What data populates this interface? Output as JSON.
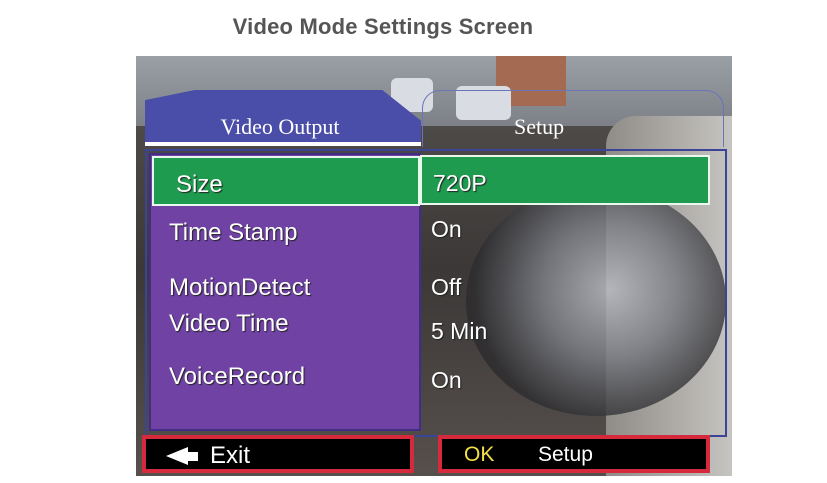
{
  "caption": "Video Mode Settings Screen",
  "tabs": {
    "active": "Video Output",
    "inactive": "Setup"
  },
  "menu": {
    "selected_index": 0,
    "items": [
      {
        "label": "Size",
        "value": "720P"
      },
      {
        "label": "Time Stamp",
        "value": "On"
      },
      {
        "label": "MotionDetect",
        "value": "Off"
      },
      {
        "label": "Video Time",
        "value": "5 Min"
      },
      {
        "label": "VoiceRecord",
        "value": "On"
      }
    ]
  },
  "footer": {
    "exit_label": "Exit",
    "ok_label": "OK",
    "ok_action_label": "Setup"
  },
  "colors": {
    "menu_background": "#6f42a3",
    "selection": "#1e9b4e",
    "tab": "#4a4ea8",
    "button_border": "#d52a3b",
    "ok_text": "#f4e04a"
  }
}
